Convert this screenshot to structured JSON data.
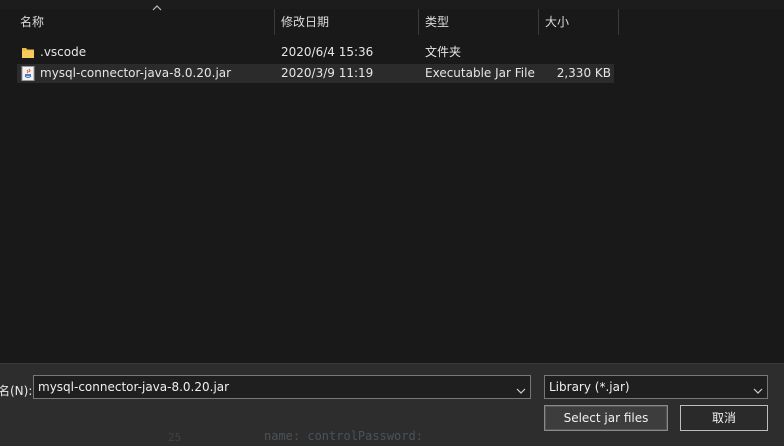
{
  "columns": [
    {
      "label": "名称"
    },
    {
      "label": "修改日期"
    },
    {
      "label": "类型"
    },
    {
      "label": "大小"
    }
  ],
  "files": [
    {
      "name": ".vscode",
      "date": "2020/6/4 15:36",
      "type": "文件夹",
      "size": "",
      "icon": "folder-icon"
    },
    {
      "name": "mysql-connector-java-8.0.20.jar",
      "date": "2020/3/9 11:19",
      "type": "Executable Jar File",
      "size": "2,330 KB",
      "icon": "jar-file-icon"
    }
  ],
  "filename": {
    "label": "名(N):",
    "value": "mysql-connector-java-8.0.20.jar"
  },
  "filter": {
    "selected": "Library (*.jar)"
  },
  "buttons": {
    "select": "Select jar files",
    "cancel": "取消"
  },
  "background": {
    "text": "name: controlPassword:",
    "text2": "25"
  }
}
